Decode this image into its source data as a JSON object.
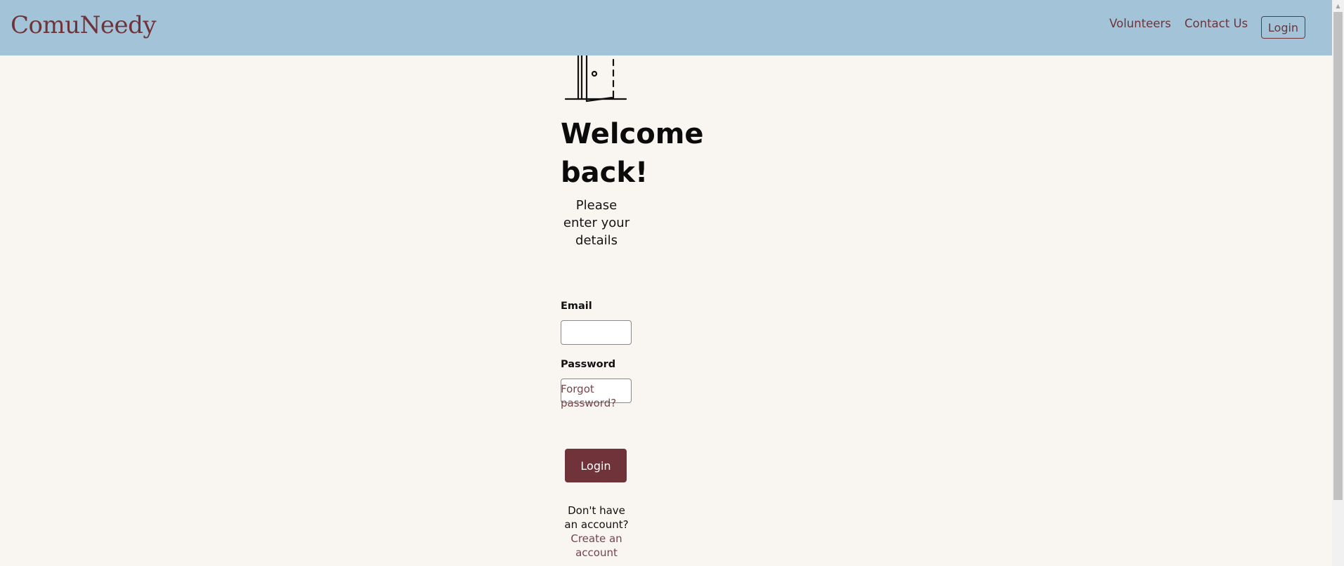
{
  "navbar": {
    "brand": "ComuNeedy",
    "links": [
      "Volunteers",
      "Contact Us"
    ],
    "login_label": "Login"
  },
  "login_form": {
    "title": "Welcome back!",
    "subtitle": "Please enter your details",
    "email_label": "Email",
    "email_value": "",
    "password_label": "Password",
    "password_value": "",
    "forgot_label": "Forgot password?",
    "submit_label": "Login",
    "signup_prompt": "Don't have an account?",
    "signup_link": "Create an account"
  },
  "icons": {
    "hero": "door-icon",
    "scroll": "scroll-up-arrow-icon"
  },
  "colors": {
    "navbar_bg": "#a3c4d8",
    "brand": "#6f3339",
    "page_bg": "#f9f5f1",
    "button_bg": "#6f3339",
    "link": "#74464a"
  }
}
